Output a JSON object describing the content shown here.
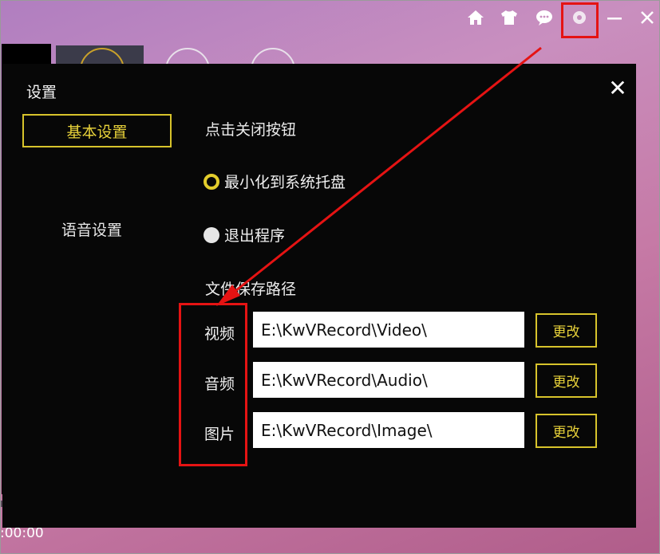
{
  "topbar": {
    "icons": [
      "home-icon",
      "tshirt-icon",
      "chat-icon",
      "gear-icon",
      "minimize-icon",
      "close-icon"
    ]
  },
  "background": {
    "time": ":00:00"
  },
  "dialog": {
    "title": "设置",
    "close_glyph": "✕",
    "nav": {
      "basic": "基本设置",
      "voice": "语音设置"
    },
    "close_behavior": {
      "heading": "点击关闭按钮",
      "options": [
        {
          "label": "最小化到系统托盘",
          "selected": true
        },
        {
          "label": "退出程序",
          "selected": false
        }
      ]
    },
    "save_paths": {
      "heading": "文件保存路径",
      "rows": [
        {
          "label": "视频",
          "value": "E:\\KwVRecord\\Video\\",
          "button": "更改"
        },
        {
          "label": "音频",
          "value": "E:\\KwVRecord\\Audio\\",
          "button": "更改"
        },
        {
          "label": "图片",
          "value": "E:\\KwVRecord\\Image\\",
          "button": "更改"
        }
      ]
    }
  },
  "colors": {
    "accent": "#d7c32b",
    "annotation": "#e51313",
    "dialog_bg": "#070707"
  }
}
